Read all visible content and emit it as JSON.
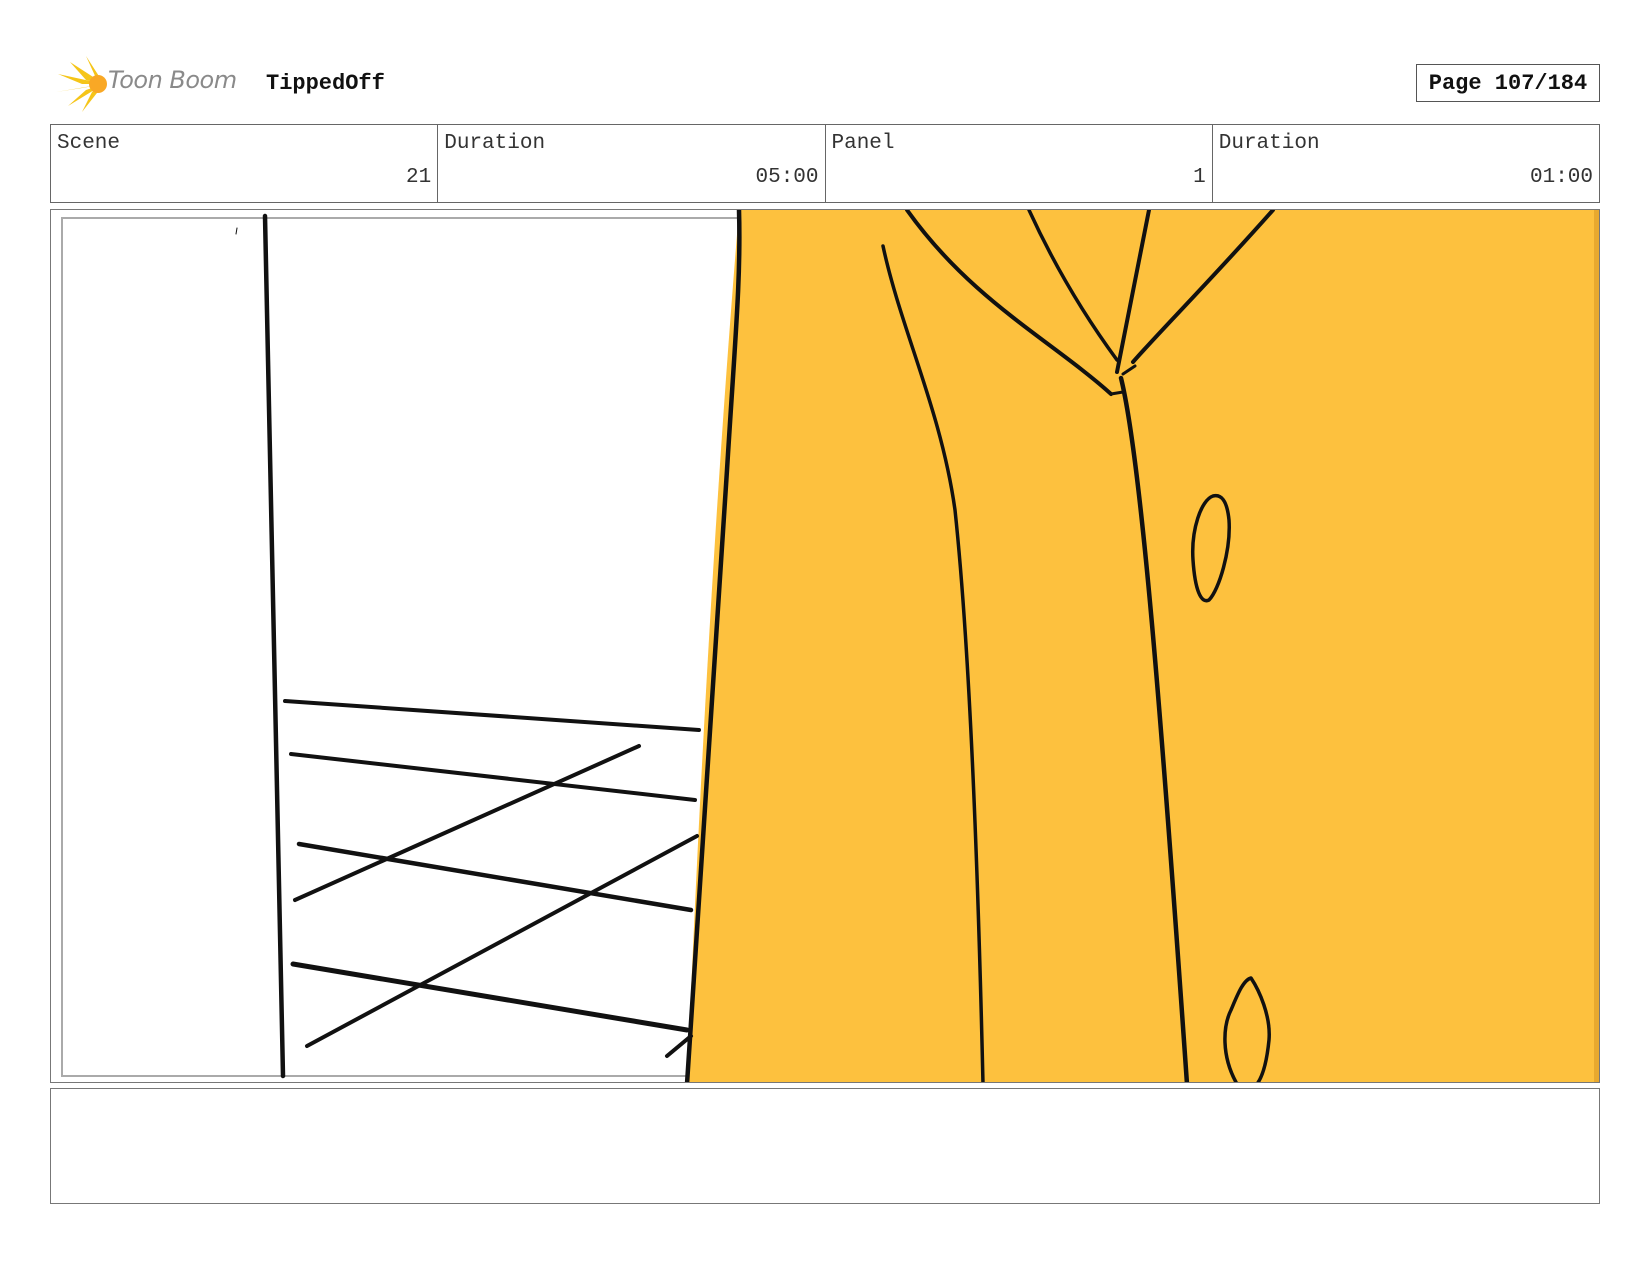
{
  "header": {
    "logo_text": "Toon Boom",
    "project_title": "TippedOff",
    "page_label": "Page 107/184"
  },
  "info": {
    "scene_label": "Scene",
    "scene_value": "21",
    "scene_duration_label": "Duration",
    "scene_duration_value": "05:00",
    "panel_label": "Panel",
    "panel_value": "1",
    "panel_duration_label": "Duration",
    "panel_duration_value": "01:00"
  },
  "colors": {
    "fill_yellow": "#FDC13E",
    "ink": "#111111",
    "logo_star": "#F5C518"
  },
  "notes": {
    "text": ""
  }
}
